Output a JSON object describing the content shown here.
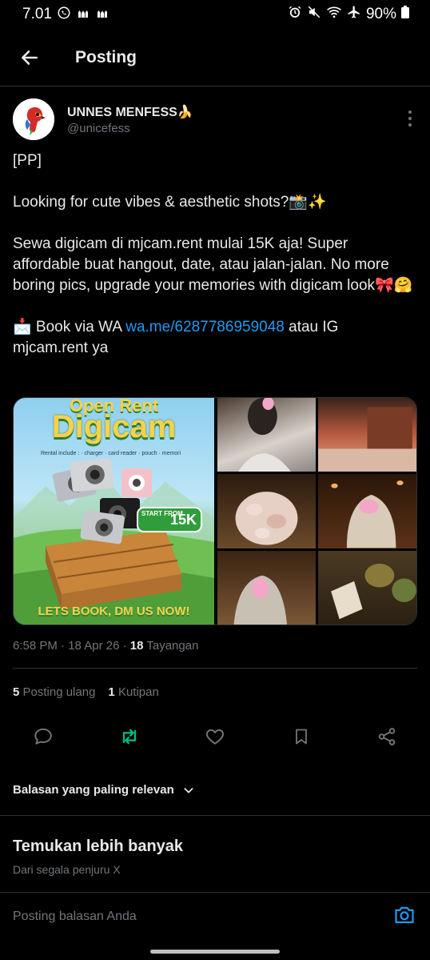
{
  "statusbar": {
    "time": "7.01",
    "battery": "90%"
  },
  "topbar": {
    "title": "Posting"
  },
  "author": {
    "name": "UNNES MENFESS🍌",
    "handle": "@unicefess"
  },
  "post": {
    "line1": "[PP]",
    "line2": "Looking for cute vibes & aesthetic shots?📸✨",
    "line3": "Sewa digicam di mjcam.rent mulai 15K aja! Super affordable buat hangout, date, atau jalan-jalan. No more boring pics, upgrade your memories with digicam look🎀🤗",
    "line4_prefix": "📩 Book via WA ",
    "link": "wa.me/6287786959048",
    "line4_suffix": " atau IG mjcam.rent ya"
  },
  "media": {
    "poster_title_1": "Open Rent",
    "poster_title_2": "Digicam",
    "poster_sub": "Rental include : · charger · card reader · pouch · memori",
    "poster_price_label": "START FROM",
    "poster_price": "15K",
    "poster_cta": "LETS BOOK, DM US NOW!"
  },
  "meta": {
    "time": "6:58 PM",
    "date": "18 Apr 26",
    "views": "18",
    "views_label": "Tayangan"
  },
  "stats": {
    "reposts": "5",
    "reposts_label": "Posting ulang",
    "quotes": "1",
    "quotes_label": "Kutipan"
  },
  "sort": {
    "label": "Balasan yang paling relevan"
  },
  "discover": {
    "title": "Temukan lebih banyak",
    "subtitle": "Dari segala penjuru X"
  },
  "reply": {
    "placeholder": "Posting balasan Anda"
  },
  "colors": {
    "accent": "#1d9bf0",
    "repost": "#00ba7c",
    "muted": "#71767b"
  }
}
